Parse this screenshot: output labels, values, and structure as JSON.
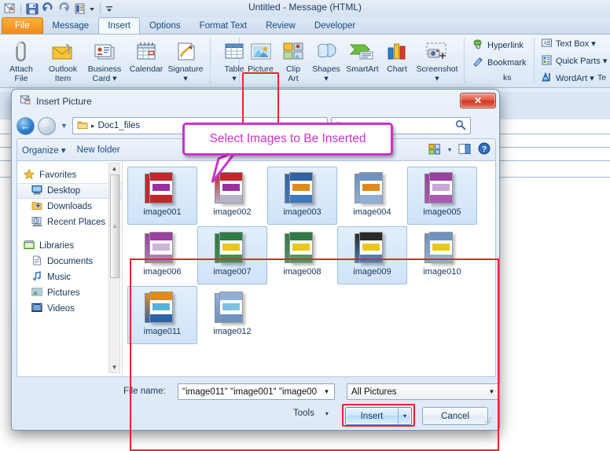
{
  "window": {
    "title": "Untitled  -  Message (HTML)",
    "quick_access": [
      "message-icon",
      "save-icon",
      "undo-icon",
      "redo-icon",
      "print-preview-icon",
      "dropdown-arrow",
      "customize-arrow"
    ]
  },
  "ribbon": {
    "tabs": [
      {
        "label": "File",
        "kind": "file"
      },
      {
        "label": "Message",
        "kind": "normal"
      },
      {
        "label": "Insert",
        "kind": "active"
      },
      {
        "label": "Options",
        "kind": "normal"
      },
      {
        "label": "Format Text",
        "kind": "normal"
      },
      {
        "label": "Review",
        "kind": "normal"
      },
      {
        "label": "Developer",
        "kind": "normal"
      }
    ],
    "include_group": [
      {
        "label": "Attach\nFile",
        "line1": "Attach",
        "line2": "File",
        "icon": "paperclip-icon"
      },
      {
        "label": "Outlook\nItem",
        "line1": "Outlook",
        "line2": "Item",
        "icon": "envelope-clip-icon"
      },
      {
        "label": "Business\nCard",
        "line1": "Business",
        "line2": "Card ▾",
        "icon": "business-card-icon"
      },
      {
        "label": "Calendar",
        "line1": "Calendar",
        "line2": "",
        "icon": "calendar-icon"
      },
      {
        "label": "Signature",
        "line1": "Signature",
        "line2": "▾",
        "icon": "signature-icon"
      }
    ],
    "tables_group": [
      {
        "line1": "Table",
        "line2": "▾",
        "icon": "table-icon"
      }
    ],
    "illustrations_group": [
      {
        "line1": "Picture",
        "line2": "",
        "icon": "picture-icon",
        "highlighted": true
      },
      {
        "line1": "Clip",
        "line2": "Art",
        "icon": "clip-art-icon"
      },
      {
        "line1": "Shapes",
        "line2": "▾",
        "icon": "shapes-icon"
      },
      {
        "line1": "SmartArt",
        "line2": "",
        "icon": "smartart-icon"
      },
      {
        "line1": "Chart",
        "line2": "",
        "icon": "chart-icon"
      },
      {
        "line1": "Screenshot",
        "line2": "▾",
        "icon": "screenshot-icon"
      }
    ],
    "links_group": [
      {
        "label": "Hyperlink",
        "icon": "globe-link-icon"
      },
      {
        "label": "Bookmark",
        "icon": "bookmark-icon"
      }
    ],
    "text_group": [
      {
        "label": "Text Box ▾",
        "icon": "text-box-icon"
      },
      {
        "label": "Quick Parts ▾",
        "icon": "quick-parts-icon"
      },
      {
        "label": "WordArt ▾",
        "icon": "wordart-icon"
      }
    ],
    "group_labels": {
      "links": "ks",
      "text": "Te"
    }
  },
  "dialog": {
    "title": "Insert Picture",
    "close_label": "✕",
    "address": {
      "folder": "Doc1_files",
      "separator": "▸"
    },
    "search": {
      "placeholder": "Search Doc1_files",
      "visible_text": "files",
      "icon": "search-icon"
    },
    "commands": {
      "organize": "Organize ▾",
      "new_folder": "New folder",
      "views_icon": "views-icon",
      "views_arrow": "▾",
      "preview_pane_icon": "preview-pane-icon",
      "help_icon": "help-icon"
    },
    "nav_pane": [
      {
        "label": "Favorites",
        "icon": "star-icon",
        "type": "header",
        "selected": false
      },
      {
        "label": "Desktop",
        "icon": "desktop-icon",
        "type": "item",
        "selected": true
      },
      {
        "label": "Downloads",
        "icon": "downloads-icon",
        "type": "item",
        "selected": false
      },
      {
        "label": "Recent Places",
        "icon": "recent-places-icon",
        "type": "item",
        "selected": false
      },
      {
        "label": "Libraries",
        "icon": "libraries-icon",
        "type": "header",
        "selected": false
      },
      {
        "label": "Documents",
        "icon": "documents-icon",
        "type": "item",
        "selected": false
      },
      {
        "label": "Music",
        "icon": "music-icon",
        "type": "item",
        "selected": false
      },
      {
        "label": "Pictures",
        "icon": "pictures-icon",
        "type": "item",
        "selected": false
      },
      {
        "label": "Videos",
        "icon": "videos-icon",
        "type": "item",
        "selected": false
      }
    ],
    "files": [
      {
        "name": "image001",
        "selected": true,
        "top": "#c0282e",
        "bot": "#c0282e",
        "strip": "#9b2fa0"
      },
      {
        "name": "image002",
        "selected": false,
        "top": "#c0282e",
        "bot": "#b8b3c9",
        "strip": "#9b2fa0"
      },
      {
        "name": "image003",
        "selected": true,
        "top": "#2f63a8",
        "bot": "#3f78bd",
        "strip": "#e08a1e"
      },
      {
        "name": "image004",
        "selected": false,
        "top": "#6f93c0",
        "bot": "#8fb0d4",
        "strip": "#e08a1e"
      },
      {
        "name": "image005",
        "selected": true,
        "top": "#9b3fa3",
        "bot": "#a85cb0",
        "strip": "#c9a6d6"
      },
      {
        "name": "image006",
        "selected": false,
        "top": "#9b3fa3",
        "bot": "#b07ab8",
        "strip": "#cdb5d8"
      },
      {
        "name": "image007",
        "selected": true,
        "top": "#2f7a46",
        "bot": "#3d8f55",
        "strip": "#e8c81e"
      },
      {
        "name": "image008",
        "selected": false,
        "top": "#2f7a46",
        "bot": "#4e9a64",
        "strip": "#e8c81e"
      },
      {
        "name": "image009",
        "selected": true,
        "top": "#2a2a2a",
        "bot": "#4b7fc0",
        "strip": "#e8c81e"
      },
      {
        "name": "image010",
        "selected": false,
        "top": "#6f93c0",
        "bot": "#8fb0d4",
        "strip": "#e8c81e"
      },
      {
        "name": "image011",
        "selected": true,
        "top": "#e08a1e",
        "bot": "#2f63a8",
        "strip": "#5ab0d8"
      },
      {
        "name": "image012",
        "selected": false,
        "top": "#8fb0d4",
        "bot": "#6f93c0",
        "strip": "#7cc2e0"
      }
    ],
    "form": {
      "file_name_label": "File name:",
      "file_name_value": "\"image011\" \"image001\" \"image00",
      "filter_value": "All Pictures",
      "tools_label": "Tools",
      "tools_arrow": "▾",
      "insert_label": "Insert",
      "insert_arrow": "▾",
      "cancel_label": "Cancel"
    }
  },
  "annotation": {
    "callout_text": "Select Images to Be Inserted",
    "callout_color": "#cc33cc",
    "highlight_color": "#e8262c"
  }
}
